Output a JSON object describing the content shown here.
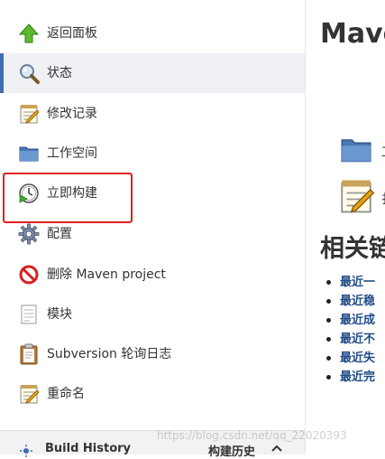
{
  "sidebar": {
    "items": [
      {
        "label": "返回面板",
        "icon": "up-arrow-icon",
        "active": false
      },
      {
        "label": "状态",
        "icon": "search-icon",
        "active": true
      },
      {
        "label": "修改记录",
        "icon": "notepad-icon",
        "active": false
      },
      {
        "label": "工作空间",
        "icon": "folder-icon",
        "active": false
      },
      {
        "label": "立即构建",
        "icon": "build-clock-icon",
        "active": false
      },
      {
        "label": "配置",
        "icon": "gear-icon",
        "active": false
      },
      {
        "label": "删除 Maven project",
        "icon": "no-entry-icon",
        "active": false
      },
      {
        "label": "模块",
        "icon": "document-icon",
        "active": false
      },
      {
        "label": "Subversion 轮询日志",
        "icon": "clipboard-icon",
        "active": false
      },
      {
        "label": "重命名",
        "icon": "notepad-pencil-icon",
        "active": false
      }
    ]
  },
  "footer": {
    "title": "Build History",
    "title_cn": "构建历史",
    "icon": "sun-icon",
    "toggle_icon": "chevron-up-icon"
  },
  "main": {
    "title": "Mave",
    "section_title": "相关链",
    "icon_items": [
      {
        "icon": "folder-icon",
        "label": "工"
      },
      {
        "icon": "notepad-pencil-icon",
        "label": "扌"
      }
    ],
    "links": [
      "最近一",
      "最近稳",
      "最近成",
      "最近不",
      "最近失",
      "最近完"
    ]
  },
  "watermark": "https://blog.csdn.net/qq_22020393",
  "colors": {
    "accent": "#3d6db2",
    "link": "#204a87",
    "highlight": "#e02020",
    "active_bg": "#eff1f5"
  }
}
